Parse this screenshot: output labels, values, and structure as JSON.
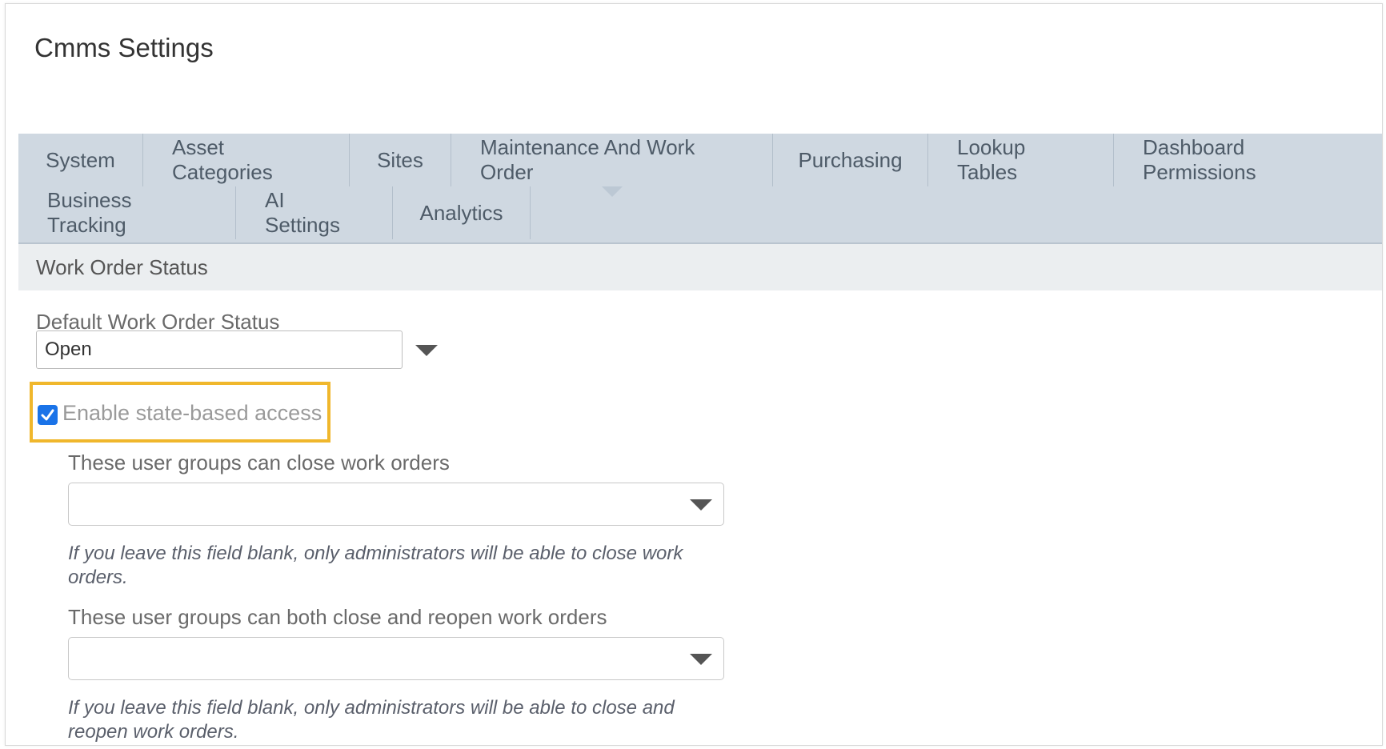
{
  "page": {
    "title": "Cmms Settings"
  },
  "tabs": {
    "row1": [
      {
        "label": "System"
      },
      {
        "label": "Asset Categories"
      },
      {
        "label": "Sites"
      },
      {
        "label": "Maintenance And Work Order",
        "active": true
      },
      {
        "label": "Purchasing"
      },
      {
        "label": "Lookup Tables"
      },
      {
        "label": "Dashboard Permissions"
      }
    ],
    "row2": [
      {
        "label": "Business Tracking"
      },
      {
        "label": "AI Settings"
      },
      {
        "label": "Analytics"
      }
    ]
  },
  "section": {
    "title": "Work Order Status"
  },
  "default_status": {
    "label": "Default Work Order Status",
    "value": "Open"
  },
  "state_access": {
    "label": "Enable state-based access",
    "checked": true
  },
  "close_groups": {
    "label": "These user groups can close work orders",
    "value": "",
    "hint": "If you leave this field blank, only administrators will be able to close work orders."
  },
  "reopen_groups": {
    "label": "These user groups can both close and reopen work orders",
    "value": "",
    "hint": "If you leave this field blank, only administrators will be able to close and reopen work orders."
  },
  "colors": {
    "highlight": "#f0b72c",
    "checkbox": "#1a73e8",
    "tab_bar": "#cfd8e1"
  }
}
